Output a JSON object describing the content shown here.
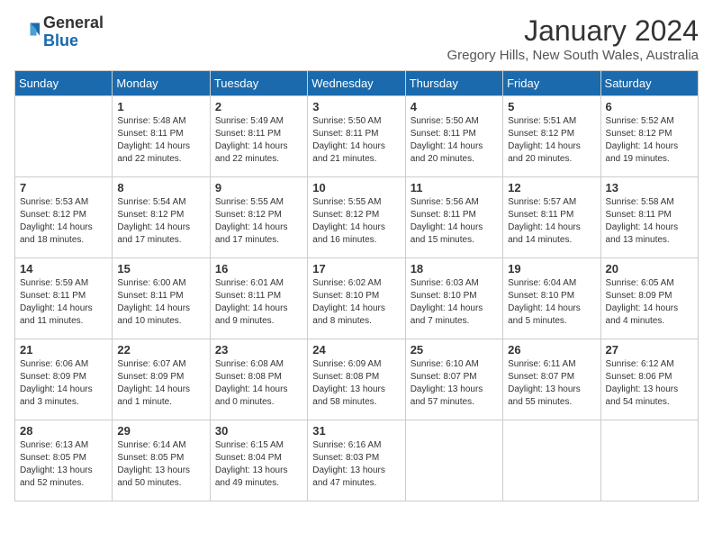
{
  "logo": {
    "general": "General",
    "blue": "Blue"
  },
  "title": "January 2024",
  "subtitle": "Gregory Hills, New South Wales, Australia",
  "days_of_week": [
    "Sunday",
    "Monday",
    "Tuesday",
    "Wednesday",
    "Thursday",
    "Friday",
    "Saturday"
  ],
  "weeks": [
    [
      {
        "day": "",
        "info": ""
      },
      {
        "day": "1",
        "info": "Sunrise: 5:48 AM\nSunset: 8:11 PM\nDaylight: 14 hours\nand 22 minutes."
      },
      {
        "day": "2",
        "info": "Sunrise: 5:49 AM\nSunset: 8:11 PM\nDaylight: 14 hours\nand 22 minutes."
      },
      {
        "day": "3",
        "info": "Sunrise: 5:50 AM\nSunset: 8:11 PM\nDaylight: 14 hours\nand 21 minutes."
      },
      {
        "day": "4",
        "info": "Sunrise: 5:50 AM\nSunset: 8:11 PM\nDaylight: 14 hours\nand 20 minutes."
      },
      {
        "day": "5",
        "info": "Sunrise: 5:51 AM\nSunset: 8:12 PM\nDaylight: 14 hours\nand 20 minutes."
      },
      {
        "day": "6",
        "info": "Sunrise: 5:52 AM\nSunset: 8:12 PM\nDaylight: 14 hours\nand 19 minutes."
      }
    ],
    [
      {
        "day": "7",
        "info": "Sunrise: 5:53 AM\nSunset: 8:12 PM\nDaylight: 14 hours\nand 18 minutes."
      },
      {
        "day": "8",
        "info": "Sunrise: 5:54 AM\nSunset: 8:12 PM\nDaylight: 14 hours\nand 17 minutes."
      },
      {
        "day": "9",
        "info": "Sunrise: 5:55 AM\nSunset: 8:12 PM\nDaylight: 14 hours\nand 17 minutes."
      },
      {
        "day": "10",
        "info": "Sunrise: 5:55 AM\nSunset: 8:12 PM\nDaylight: 14 hours\nand 16 minutes."
      },
      {
        "day": "11",
        "info": "Sunrise: 5:56 AM\nSunset: 8:11 PM\nDaylight: 14 hours\nand 15 minutes."
      },
      {
        "day": "12",
        "info": "Sunrise: 5:57 AM\nSunset: 8:11 PM\nDaylight: 14 hours\nand 14 minutes."
      },
      {
        "day": "13",
        "info": "Sunrise: 5:58 AM\nSunset: 8:11 PM\nDaylight: 14 hours\nand 13 minutes."
      }
    ],
    [
      {
        "day": "14",
        "info": "Sunrise: 5:59 AM\nSunset: 8:11 PM\nDaylight: 14 hours\nand 11 minutes."
      },
      {
        "day": "15",
        "info": "Sunrise: 6:00 AM\nSunset: 8:11 PM\nDaylight: 14 hours\nand 10 minutes."
      },
      {
        "day": "16",
        "info": "Sunrise: 6:01 AM\nSunset: 8:11 PM\nDaylight: 14 hours\nand 9 minutes."
      },
      {
        "day": "17",
        "info": "Sunrise: 6:02 AM\nSunset: 8:10 PM\nDaylight: 14 hours\nand 8 minutes."
      },
      {
        "day": "18",
        "info": "Sunrise: 6:03 AM\nSunset: 8:10 PM\nDaylight: 14 hours\nand 7 minutes."
      },
      {
        "day": "19",
        "info": "Sunrise: 6:04 AM\nSunset: 8:10 PM\nDaylight: 14 hours\nand 5 minutes."
      },
      {
        "day": "20",
        "info": "Sunrise: 6:05 AM\nSunset: 8:09 PM\nDaylight: 14 hours\nand 4 minutes."
      }
    ],
    [
      {
        "day": "21",
        "info": "Sunrise: 6:06 AM\nSunset: 8:09 PM\nDaylight: 14 hours\nand 3 minutes."
      },
      {
        "day": "22",
        "info": "Sunrise: 6:07 AM\nSunset: 8:09 PM\nDaylight: 14 hours\nand 1 minute."
      },
      {
        "day": "23",
        "info": "Sunrise: 6:08 AM\nSunset: 8:08 PM\nDaylight: 14 hours\nand 0 minutes."
      },
      {
        "day": "24",
        "info": "Sunrise: 6:09 AM\nSunset: 8:08 PM\nDaylight: 13 hours\nand 58 minutes."
      },
      {
        "day": "25",
        "info": "Sunrise: 6:10 AM\nSunset: 8:07 PM\nDaylight: 13 hours\nand 57 minutes."
      },
      {
        "day": "26",
        "info": "Sunrise: 6:11 AM\nSunset: 8:07 PM\nDaylight: 13 hours\nand 55 minutes."
      },
      {
        "day": "27",
        "info": "Sunrise: 6:12 AM\nSunset: 8:06 PM\nDaylight: 13 hours\nand 54 minutes."
      }
    ],
    [
      {
        "day": "28",
        "info": "Sunrise: 6:13 AM\nSunset: 8:05 PM\nDaylight: 13 hours\nand 52 minutes."
      },
      {
        "day": "29",
        "info": "Sunrise: 6:14 AM\nSunset: 8:05 PM\nDaylight: 13 hours\nand 50 minutes."
      },
      {
        "day": "30",
        "info": "Sunrise: 6:15 AM\nSunset: 8:04 PM\nDaylight: 13 hours\nand 49 minutes."
      },
      {
        "day": "31",
        "info": "Sunrise: 6:16 AM\nSunset: 8:03 PM\nDaylight: 13 hours\nand 47 minutes."
      },
      {
        "day": "",
        "info": ""
      },
      {
        "day": "",
        "info": ""
      },
      {
        "day": "",
        "info": ""
      }
    ]
  ]
}
